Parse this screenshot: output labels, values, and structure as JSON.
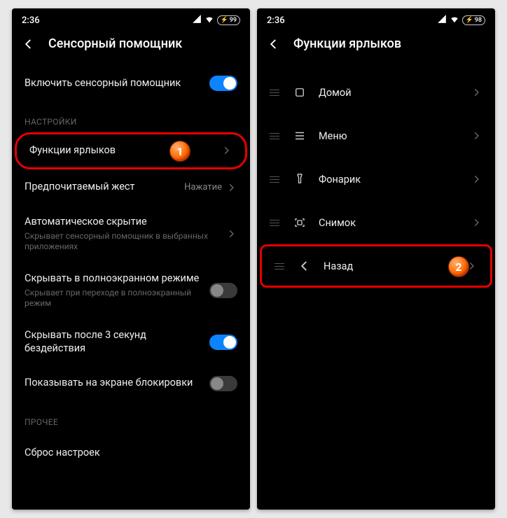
{
  "left": {
    "status": {
      "time": "2:36",
      "battery": "99"
    },
    "title": "Сенсорный помощник",
    "enable_row": "Включить сенсорный помощник",
    "enable_on": true,
    "sections": {
      "settings": "НАСТРОЙКИ",
      "other": "ПРОЧЕЕ"
    },
    "rows": {
      "shortcuts": "Функции ярлыков",
      "gesture": {
        "label": "Предпочитаемый жест",
        "value": "Нажатие"
      },
      "autohide": {
        "label": "Автоматическое скрытие",
        "sub": "Скрывает сенсорный помощник в выбранных приложениях"
      },
      "fullscreen": {
        "label": "Скрывать в полноэкранном режиме",
        "sub": "Скрывает при переходе в полноэкранный режим",
        "on": false
      },
      "idle": {
        "label": "Скрывать после 3 секунд бездействия",
        "on": true
      },
      "lockscreen": {
        "label": "Показывать на экране блокировки",
        "on": false
      },
      "reset": "Сброс настроек"
    }
  },
  "right": {
    "status": {
      "time": "2:36",
      "battery": "98"
    },
    "title": "Функции ярлыков",
    "items": [
      {
        "icon": "home",
        "label": "Домой"
      },
      {
        "icon": "menu",
        "label": "Меню"
      },
      {
        "icon": "flashlight",
        "label": "Фонарик"
      },
      {
        "icon": "screenshot",
        "label": "Снимок"
      },
      {
        "icon": "back",
        "label": "Назад"
      }
    ]
  },
  "markers": {
    "m1": "1",
    "m2": "2"
  }
}
